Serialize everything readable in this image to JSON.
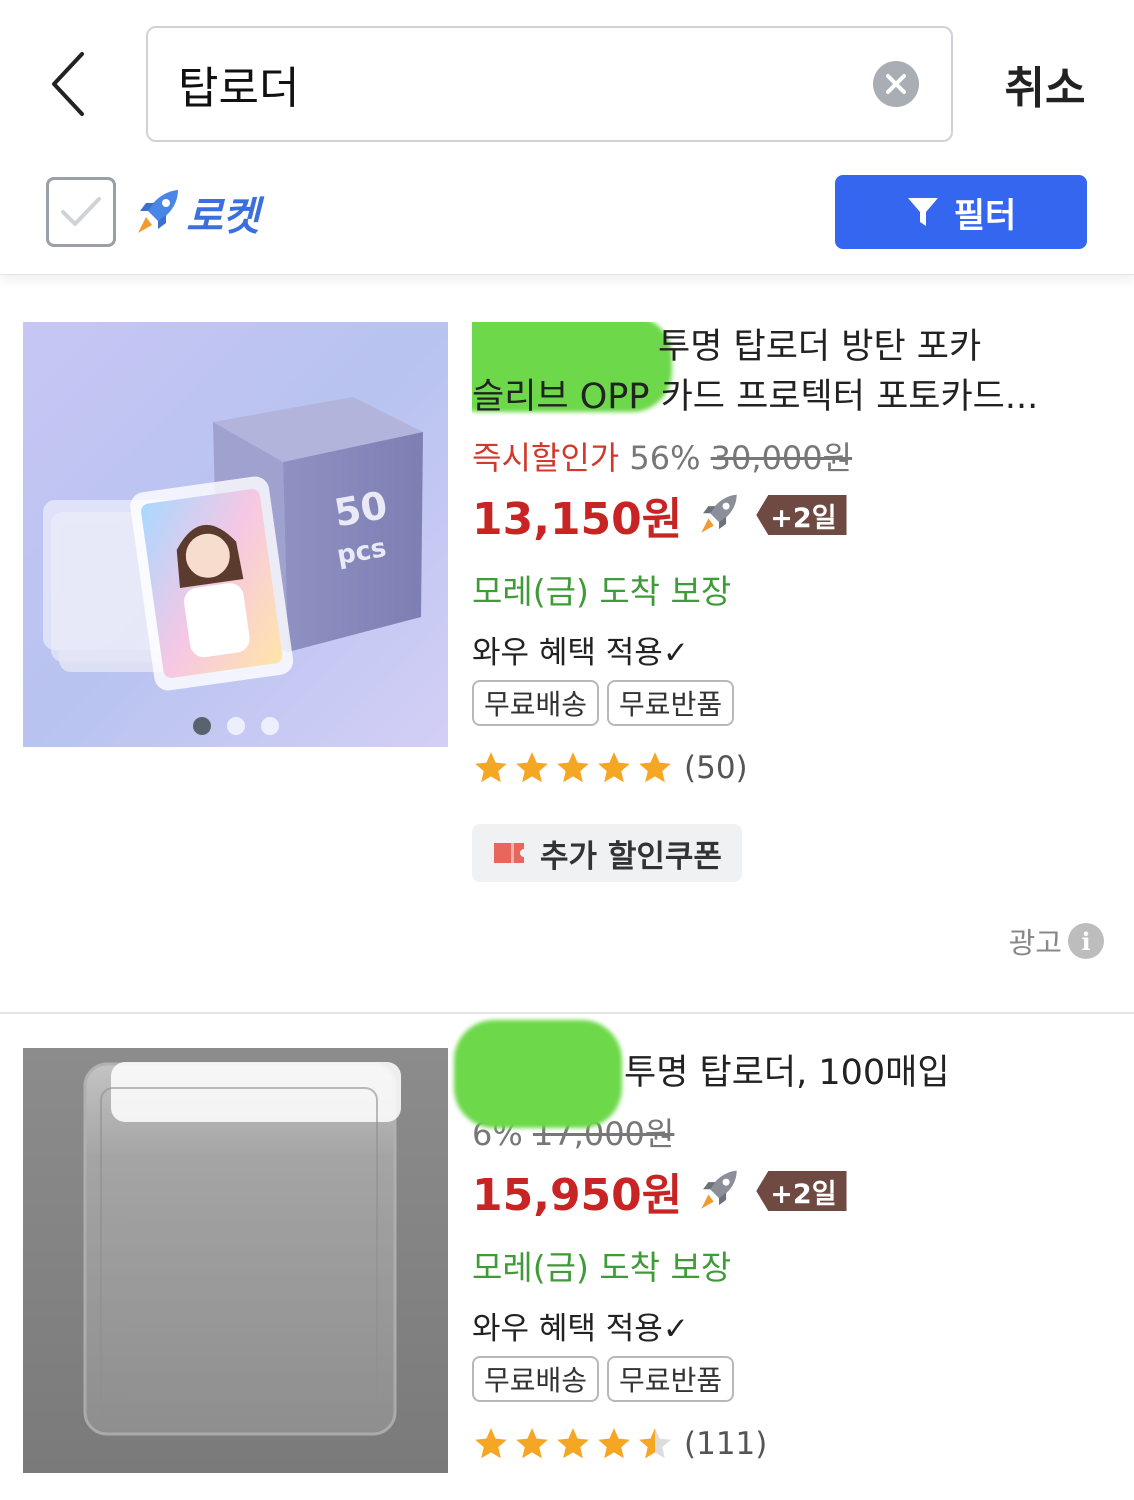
{
  "search": {
    "query": "탑로더",
    "cancel_label": "취소"
  },
  "filters": {
    "rocket_label": "로켓",
    "rocket_checked": false,
    "filter_label": "필터",
    "accent_color": "#3466ef"
  },
  "products": [
    {
      "title": "투명 탑로더 방탄 포카 슬리브 OPP 카드 프로텍터 포토카드...",
      "title_line1": "투명 탑로더 방탄 포카",
      "title_line2": "슬리브 OPP 카드 프로텍터 포토카드...",
      "instant_label": "즉시할인가",
      "discount_pct": "56%",
      "original_price": "30,000원",
      "price": "13,150원",
      "delivery_badge": "+2일",
      "arrival": "모레(금) 도착 보장",
      "wow": "와우 혜택 적용✓",
      "tags": [
        "무료배송",
        "무료반품"
      ],
      "rating": 5,
      "review_count": "(50)",
      "coupon_label": "추가 할인쿠폰",
      "ad_label": "광고",
      "image_text": "50 pcs",
      "image_dots": 3
    },
    {
      "title": "투명 탑로더, 100매입",
      "discount_pct": "6%",
      "original_price": "17,000원",
      "price": "15,950원",
      "delivery_badge": "+2일",
      "arrival": "모레(금) 도착 보장",
      "wow": "와우 혜택 적용✓",
      "tags": [
        "무료배송",
        "무료반품"
      ],
      "rating": 4.5,
      "review_count": "(111)"
    }
  ],
  "colors": {
    "price": "#c82424",
    "instant": "#d0392b",
    "arrival": "#3f9b38",
    "star": "#f5a623",
    "delivery_badge": "#6e4a43"
  }
}
